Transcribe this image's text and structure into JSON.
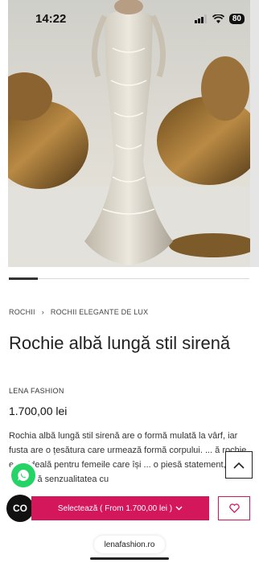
{
  "status_bar": {
    "time": "14:22",
    "battery": "80"
  },
  "gallery": {
    "progress_fraction": 0.12
  },
  "breadcrumb": {
    "items": [
      "ROCHII",
      "ROCHII ELEGANTE DE LUX"
    ],
    "separator": "›"
  },
  "product": {
    "title": "Rochie albă lungă stil sirenă",
    "brand": "LENA FASHION",
    "price": "1.700,00 lei",
    "description": "Rochia albă lungă stil sirenă are o formă mulată la vârf, iar fusta are o țesătura care urmează formă corpului. ... ă rochie este ideală pentru femeile care își ... o piesă statement, ce combină senzualitatea cu"
  },
  "actions": {
    "co_label": "CO",
    "select_label": "Selectează ( From 1.700,00 lei )",
    "accent_color": "#d4165b"
  },
  "browser": {
    "url": "lenafashion.ro"
  },
  "icons": [
    "wifi-icon",
    "signal-icon",
    "whatsapp-icon",
    "chevron-up-icon",
    "chevron-down-icon",
    "heart-icon"
  ]
}
